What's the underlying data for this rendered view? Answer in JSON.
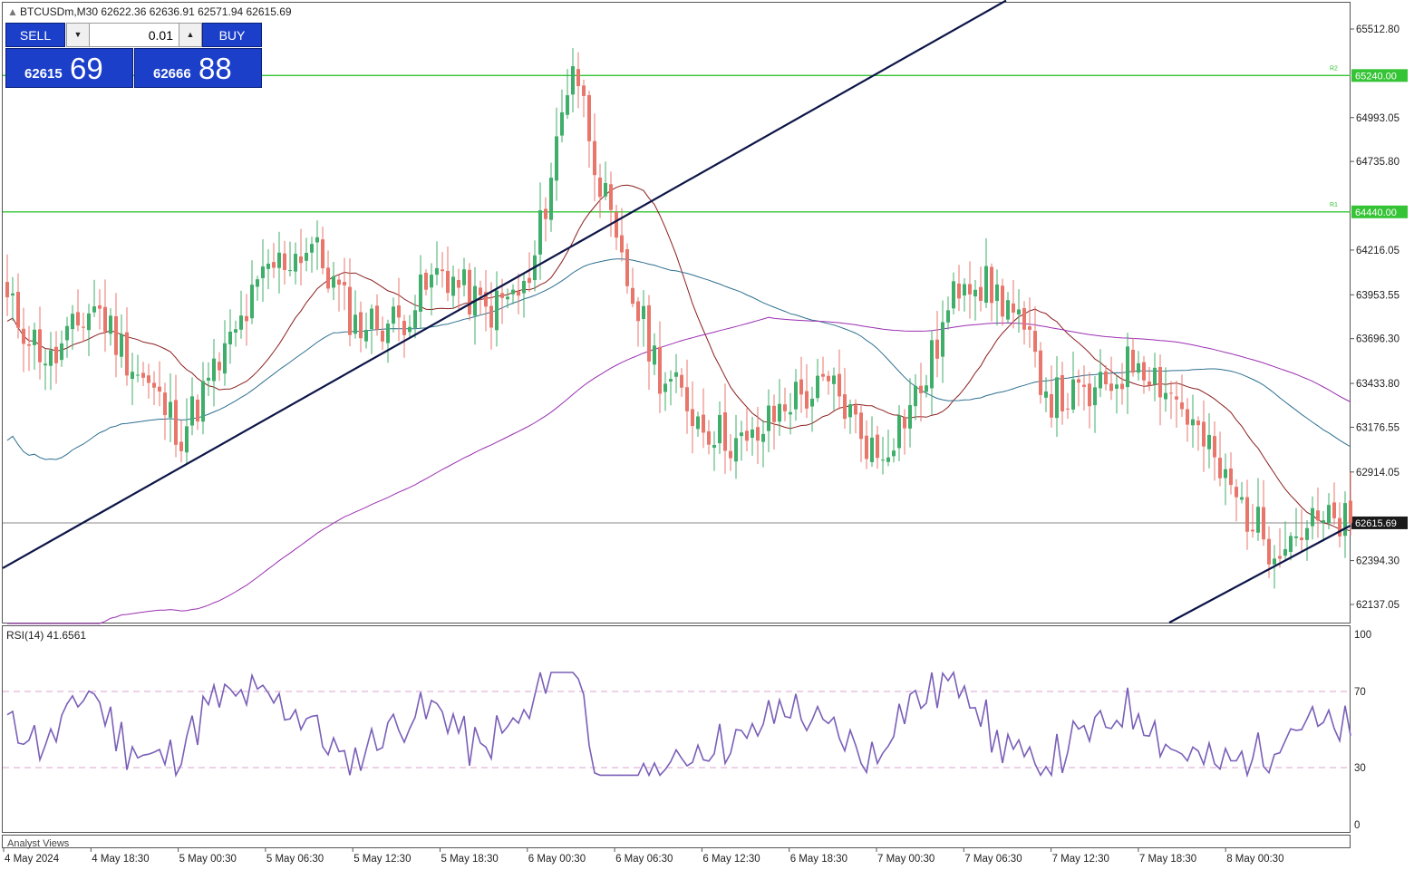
{
  "header": {
    "symbol_info": "BTCUSDm,M30  62622.36 62636.91 62571.94 62615.69"
  },
  "trade_panel": {
    "sell_label": "SELL",
    "buy_label": "BUY",
    "lot_value": "0.01",
    "sell_price_small": "62615",
    "sell_price_big": "69",
    "buy_price_small": "62666",
    "buy_price_big": "88"
  },
  "price_axis": {
    "labels": [
      "65512.80",
      "64993.05",
      "64735.80",
      "64216.05",
      "63953.55",
      "63696.30",
      "63433.80",
      "63176.55",
      "62914.05",
      "62394.30",
      "62137.05"
    ],
    "levels": [
      {
        "tag": "R2",
        "price": "65240.00",
        "color": "#35c435"
      },
      {
        "tag": "R1",
        "price": "64440.00",
        "color": "#35c435"
      }
    ],
    "current_price": "62615.69"
  },
  "rsi": {
    "label": "RSI(14) 41.6561",
    "axis_labels": [
      "100",
      "70",
      "30",
      "0"
    ],
    "levels": [
      70,
      30
    ]
  },
  "footer": {
    "analyst_views": "Analyst Views",
    "time_labels": [
      "4 May 2024",
      "4 May 18:30",
      "5 May 00:30",
      "5 May 06:30",
      "5 May 12:30",
      "5 May 18:30",
      "6 May 00:30",
      "6 May 06:30",
      "6 May 12:30",
      "6 May 18:30",
      "7 May 00:30",
      "7 May 06:30",
      "7 May 12:30",
      "7 May 18:30",
      "8 May 00:30"
    ]
  },
  "colors": {
    "bull": "#3fae6a",
    "bear": "#e8766b",
    "ma_fast": "#8b1f1f",
    "ma_mid": "#2d6f8f",
    "ma_slow": "#9b2fb2",
    "rsi_line": "#7a5fb8",
    "trendline": "#0c1547"
  },
  "chart_data": {
    "type": "candlestick",
    "symbol": "BTCUSDm",
    "timeframe": "M30",
    "ylim": [
      62000,
      65700
    ],
    "anchors": [
      [
        0,
        63900
      ],
      [
        8,
        63550
      ],
      [
        16,
        63900
      ],
      [
        24,
        63500
      ],
      [
        32,
        63150
      ],
      [
        40,
        63600
      ],
      [
        48,
        64100
      ],
      [
        56,
        64250
      ],
      [
        64,
        63780
      ],
      [
        72,
        63800
      ],
      [
        80,
        64100
      ],
      [
        88,
        63850
      ],
      [
        96,
        64000
      ],
      [
        104,
        65350
      ],
      [
        112,
        64200
      ],
      [
        120,
        63500
      ],
      [
        128,
        63200
      ],
      [
        136,
        63050
      ],
      [
        144,
        63350
      ],
      [
        152,
        63400
      ],
      [
        160,
        63000
      ],
      [
        168,
        63400
      ],
      [
        176,
        64100
      ],
      [
        184,
        63900
      ],
      [
        192,
        63350
      ],
      [
        200,
        63350
      ],
      [
        208,
        63600
      ],
      [
        216,
        63300
      ],
      [
        224,
        62850
      ],
      [
        232,
        62500
      ],
      [
        240,
        62600
      ],
      [
        247,
        62615.69
      ]
    ]
  }
}
